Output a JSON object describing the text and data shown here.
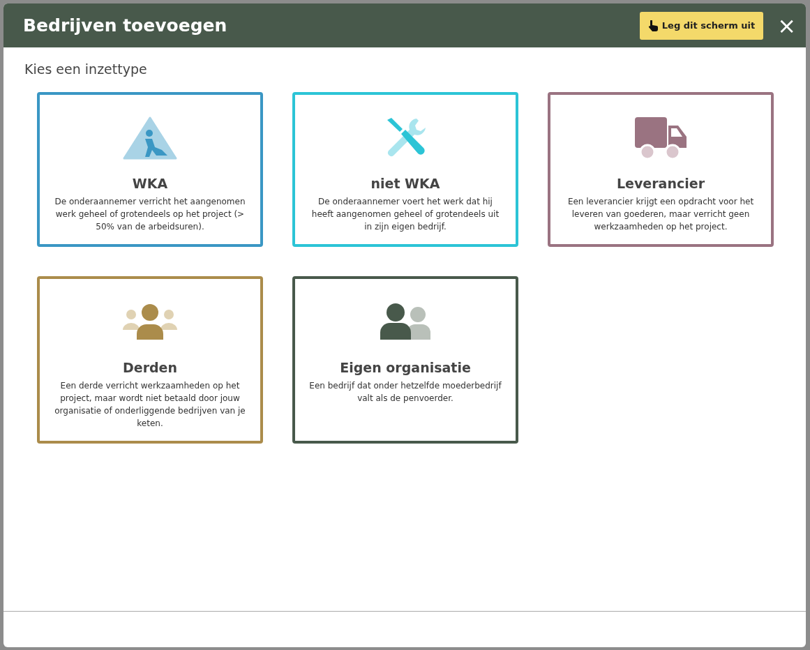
{
  "dialog": {
    "title": "Bedrijven toevoegen",
    "help_button": "Leg dit scherm uit",
    "close": "×"
  },
  "section_title": "Kies een inzettype",
  "options": [
    {
      "kind": "wka",
      "color": "#3a97c4",
      "title": "WKA",
      "description": "De onderaannemer verricht het aangenomen werk geheel of grotendeels op het project (> 50% van de arbeidsuren)."
    },
    {
      "kind": "tools",
      "color": "#2cc4d6",
      "title": "niet WKA",
      "description": "De onderaannemer voert het werk dat hij heeft aangenomen geheel of grotendeels uit in zijn eigen bedrijf."
    },
    {
      "kind": "truck",
      "color": "#9a7381",
      "title": "Leverancier",
      "description": "Een leverancier krijgt een opdracht voor het leveren van goederen, maar verricht geen werkzaamheden op het project."
    },
    {
      "kind": "group",
      "color": "#ab8c4b",
      "title": "Derden",
      "description": "Een derde verricht werkzaamheden op het project, maar wordt niet betaald door jouw organisatie of onderliggende bedrijven van je keten."
    },
    {
      "kind": "pair",
      "color": "#48594b",
      "title": "Eigen organisatie",
      "description": "Een bedrijf dat onder hetzelfde moederbedrijf valt als de penvoerder."
    }
  ]
}
